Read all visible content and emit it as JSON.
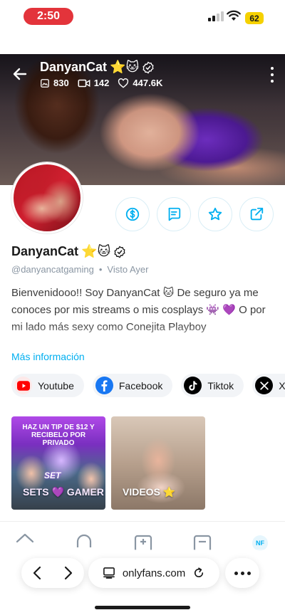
{
  "status_bar": {
    "time": "2:50",
    "battery": "62"
  },
  "cover": {
    "name": "DanyanCat",
    "name_emoji": "⭐🐱",
    "stats": {
      "photos": "830",
      "videos": "142",
      "likes": "447.6K"
    }
  },
  "profile": {
    "name": "DanyanCat",
    "name_emoji": "⭐🐱",
    "handle": "@danyancatgaming",
    "separator": "•",
    "last_seen": "Visto  Ayer",
    "bio": "Bienvenidooo!! Soy DanyanCat 🐱 De seguro ya me conoces por mis streams o mis cosplays 👾 💜 O por mi lado más sexy como Conejita Playboy",
    "more_info": "Más información"
  },
  "actions": [
    "tip",
    "message",
    "favorite",
    "share"
  ],
  "socials": [
    {
      "label": "Youtube",
      "icon": "youtube-icon",
      "color": "#ff0000"
    },
    {
      "label": "Facebook",
      "icon": "facebook-icon",
      "color": "#1877f2"
    },
    {
      "label": "Tiktok",
      "icon": "tiktok-icon",
      "color": "#000000"
    },
    {
      "label": "X",
      "icon": "x-icon",
      "color": "#000000"
    }
  ],
  "tiles": {
    "tile1": {
      "top_text": "HAZ UN TIP DE $12 Y RECIBELO POR PRIVADO",
      "badge": "SET",
      "label": "SETS 💜 GAMER"
    },
    "tile2": {
      "label": "VIDEOS ⭐"
    }
  },
  "bottom_nav": {
    "avatar_initials": "NF"
  },
  "browser": {
    "url": "onlyfans.com"
  },
  "colors": {
    "accent": "#00aff0",
    "time_pill": "#e3343b",
    "battery": "#f5d100"
  }
}
